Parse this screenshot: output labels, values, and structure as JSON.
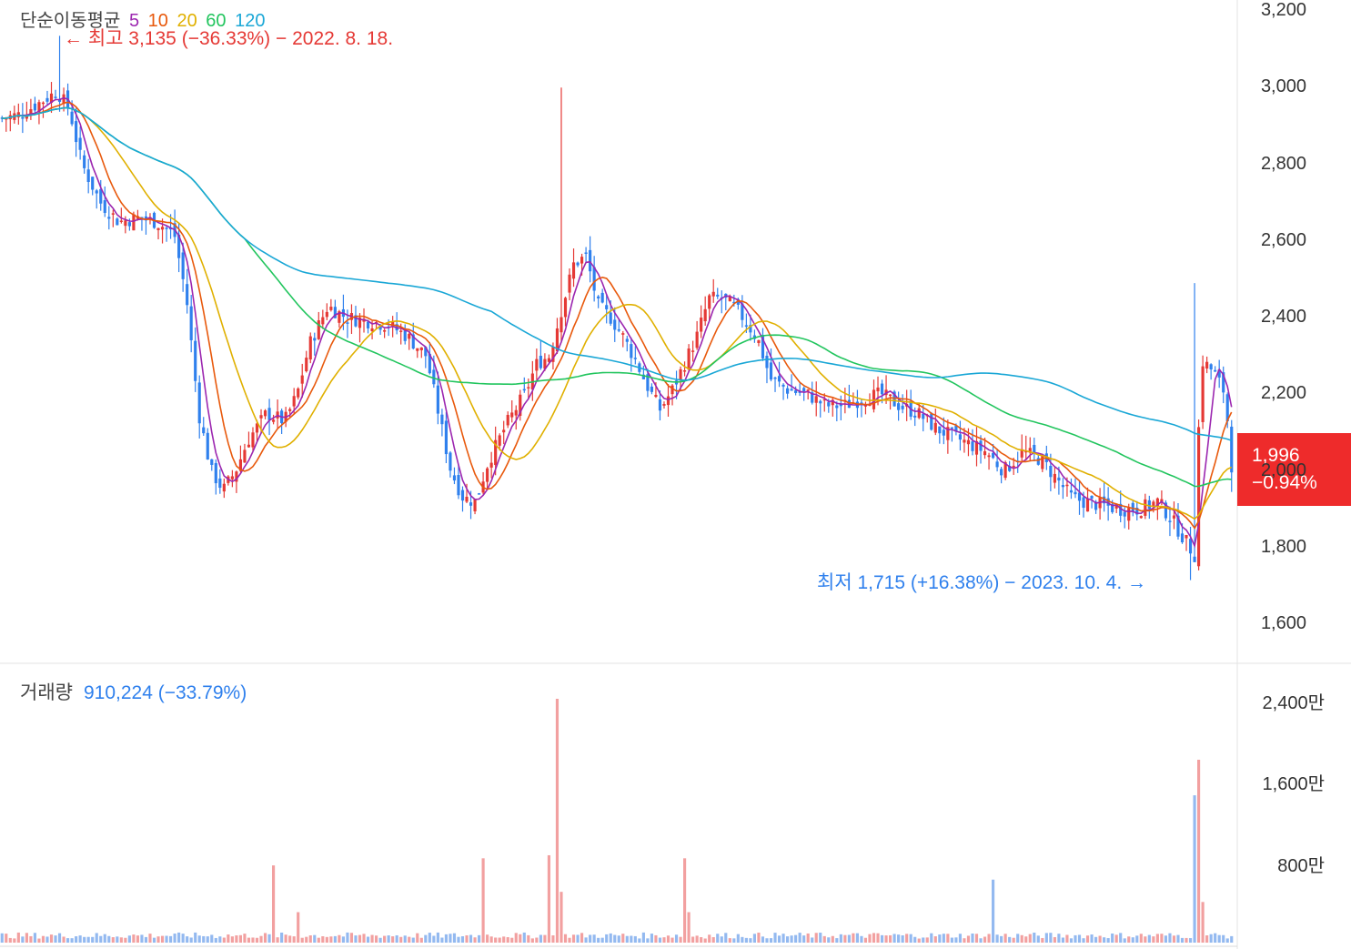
{
  "legend": {
    "title": "단순이동평균",
    "periods": [
      {
        "label": "5",
        "color": "#9c27b0"
      },
      {
        "label": "10",
        "color": "#e8590c"
      },
      {
        "label": "20",
        "color": "#e0b000"
      },
      {
        "label": "60",
        "color": "#22c55e"
      },
      {
        "label": "120",
        "color": "#1aa7d6"
      }
    ]
  },
  "annotations": {
    "high": "← 최고 3,135 (−36.33%) − 2022. 8. 18.",
    "low": "최저 1,715 (+16.38%) − 2023. 10. 4. →"
  },
  "current": {
    "price": "1,996",
    "change": "−0.94%"
  },
  "volume": {
    "title": "거래량",
    "value": "910,224 (−33.79%)"
  },
  "colors": {
    "up": "#e53935",
    "down": "#2f80ed",
    "up_vol": "#f2a0a0",
    "down_vol": "#93b9f0",
    "badge": "#ee2b2b"
  },
  "chart_data": [
    {
      "type": "candlestick",
      "title": "",
      "y_axis": {
        "ticks": [
          "3,200",
          "3,000",
          "2,800",
          "2,600",
          "2,400",
          "2,200",
          "2,000",
          "1,800",
          "1,600"
        ],
        "range": [
          1600,
          3200
        ]
      },
      "key_points": {
        "high": 3135,
        "low": 1715,
        "last": 1996
      },
      "close_path": [
        [
          0,
          2920
        ],
        [
          15,
          2930
        ],
        [
          30,
          2960
        ],
        [
          45,
          2990
        ],
        [
          55,
          2940
        ],
        [
          65,
          2800
        ],
        [
          80,
          2700
        ],
        [
          95,
          2650
        ],
        [
          110,
          2660
        ],
        [
          125,
          2650
        ],
        [
          140,
          2620
        ],
        [
          150,
          2450
        ],
        [
          160,
          2150
        ],
        [
          170,
          2000
        ],
        [
          180,
          1950
        ],
        [
          190,
          2000
        ],
        [
          200,
          2080
        ],
        [
          215,
          2150
        ],
        [
          230,
          2130
        ],
        [
          240,
          2200
        ],
        [
          250,
          2330
        ],
        [
          265,
          2430
        ],
        [
          280,
          2400
        ],
        [
          300,
          2390
        ],
        [
          315,
          2380
        ],
        [
          330,
          2350
        ],
        [
          345,
          2300
        ],
        [
          355,
          2150
        ],
        [
          365,
          2000
        ],
        [
          375,
          1930
        ],
        [
          385,
          1920
        ],
        [
          395,
          2020
        ],
        [
          410,
          2120
        ],
        [
          425,
          2200
        ],
        [
          435,
          2280
        ],
        [
          445,
          2300
        ],
        [
          455,
          2420
        ],
        [
          465,
          2540
        ],
        [
          475,
          2560
        ],
        [
          485,
          2430
        ],
        [
          495,
          2400
        ],
        [
          505,
          2350
        ],
        [
          515,
          2290
        ],
        [
          525,
          2220
        ],
        [
          535,
          2160
        ],
        [
          545,
          2210
        ],
        [
          555,
          2280
        ],
        [
          565,
          2350
        ],
        [
          575,
          2450
        ],
        [
          585,
          2450
        ],
        [
          595,
          2430
        ],
        [
          605,
          2390
        ],
        [
          615,
          2340
        ],
        [
          625,
          2240
        ],
        [
          640,
          2210
        ],
        [
          655,
          2200
        ],
        [
          670,
          2170
        ],
        [
          685,
          2170
        ],
        [
          700,
          2190
        ],
        [
          715,
          2200
        ],
        [
          730,
          2170
        ],
        [
          745,
          2150
        ],
        [
          760,
          2110
        ],
        [
          780,
          2080
        ],
        [
          800,
          2050
        ],
        [
          815,
          2000
        ],
        [
          830,
          2050
        ],
        [
          845,
          2030
        ],
        [
          860,
          1970
        ],
        [
          870,
          1930
        ],
        [
          880,
          1920
        ],
        [
          895,
          1910
        ],
        [
          910,
          1900
        ],
        [
          925,
          1900
        ],
        [
          940,
          1920
        ],
        [
          950,
          1880
        ],
        [
          960,
          1830
        ],
        [
          970,
          1780
        ],
        [
          975,
          2290
        ],
        [
          985,
          2260
        ],
        [
          995,
          2200
        ],
        [
          1000,
          1996
        ]
      ]
    },
    {
      "type": "bar",
      "title": "",
      "y_axis": {
        "ticks": [
          "2,400만",
          "1,600만",
          "800만"
        ]
      },
      "key_points": {
        "max": 24000000,
        "second": 18000000
      }
    }
  ]
}
